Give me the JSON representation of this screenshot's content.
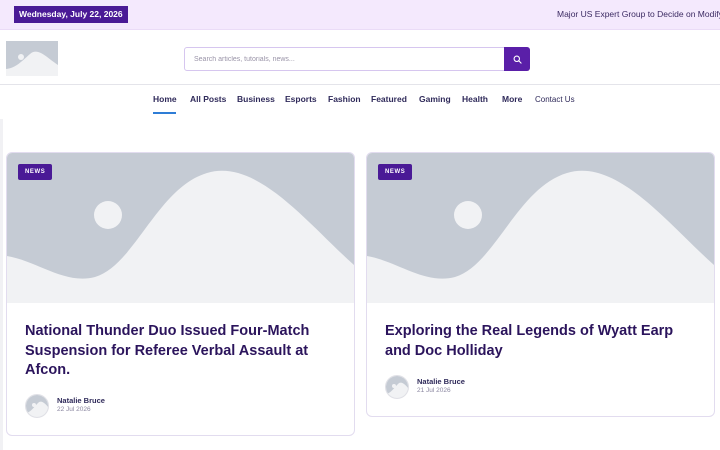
{
  "topbar": {
    "date": "Wednesday, July 22, 2026",
    "ticker": "Major US Expert Group to Decide on Modifying Ne"
  },
  "header": {
    "logo_icon": "image-placeholder-icon",
    "search": {
      "placeholder": "Search articles, tutorials, news...",
      "button_icon": "search-icon"
    }
  },
  "nav": {
    "items": [
      {
        "label": "Home",
        "active": true
      },
      {
        "label": "All Posts"
      },
      {
        "label": "Business"
      },
      {
        "label": "Esports"
      },
      {
        "label": "Fashion"
      },
      {
        "label": "Featured"
      },
      {
        "label": "Gaming"
      },
      {
        "label": "Health"
      },
      {
        "label": "More"
      },
      {
        "label": "Contact Us"
      }
    ]
  },
  "articles": [
    {
      "badge": "NEWS",
      "title": "National Thunder Duo Issued Four-Match Suspension for Referee Verbal Assault at Afcon.",
      "author": "Natalie Bruce",
      "date": "22 Jul 2026"
    },
    {
      "badge": "NEWS",
      "title": "Exploring the Real Legends of Wyatt Earp and Doc Holliday",
      "author": "Natalie Bruce",
      "date": "21 Jul 2026"
    }
  ],
  "colors": {
    "accent": "#4a1a96",
    "topbar_bg": "#f4e9fd",
    "placeholder_bg": "#c5cbd4",
    "placeholder_shape": "#f1f2f4",
    "title": "#2b145c",
    "nav_active_underline": "#2e7dd6"
  }
}
